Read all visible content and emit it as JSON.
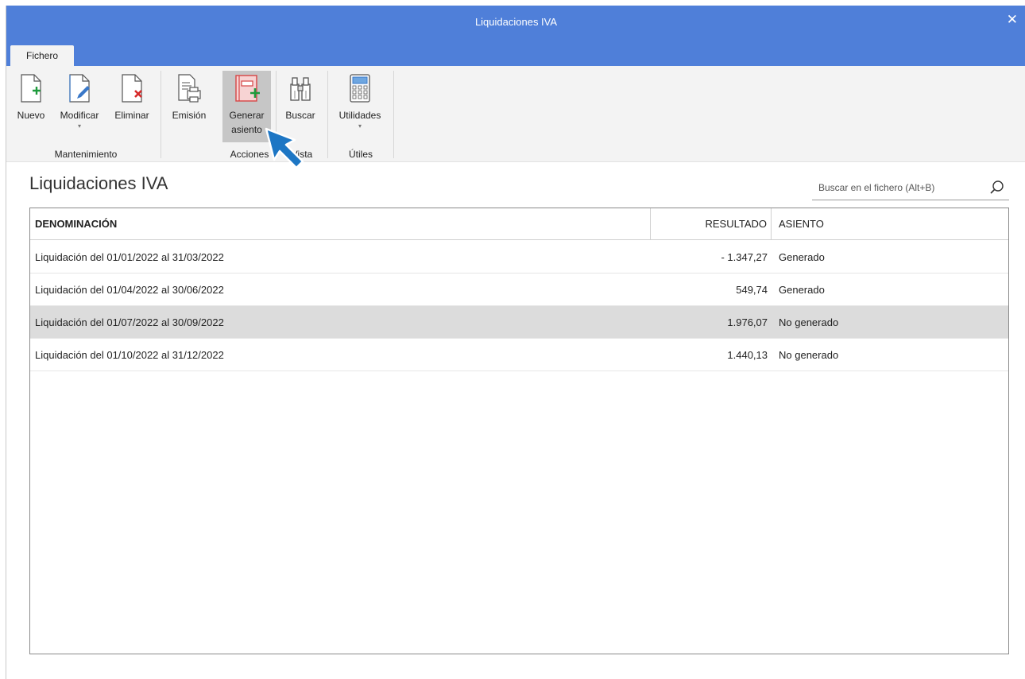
{
  "window": {
    "title": "Liquidaciones IVA",
    "close_glyph": "✕"
  },
  "tabs": [
    {
      "label": "Fichero"
    }
  ],
  "ribbon": {
    "buttons": {
      "nuevo": {
        "label": "Nuevo",
        "icon": "new-document-icon"
      },
      "modificar": {
        "label": "Modificar",
        "icon": "edit-document-icon",
        "caret": "▾"
      },
      "eliminar": {
        "label": "Eliminar",
        "icon": "delete-document-icon"
      },
      "emision": {
        "label": "Emisión",
        "icon": "print-document-icon"
      },
      "generar": {
        "label_line1": "Generar",
        "label_line2": "asiento",
        "icon": "generate-entry-icon"
      },
      "buscar": {
        "label": "Buscar",
        "icon": "binoculars-icon"
      },
      "utilidades": {
        "label": "Utilidades",
        "icon": "calculator-icon",
        "caret": "▾"
      }
    },
    "groups": {
      "mantenimiento": "Mantenimiento",
      "acciones": "Acciones",
      "vista": "Vista",
      "utiles": "Útiles"
    }
  },
  "page": {
    "title": "Liquidaciones IVA",
    "search_placeholder": "Buscar en el fichero (Alt+B)"
  },
  "table": {
    "columns": {
      "denominacion": "DENOMINACIÓN",
      "resultado": "RESULTADO",
      "asiento": "ASIENTO"
    },
    "rows": [
      {
        "denominacion": "Liquidación del 01/01/2022 al 31/03/2022",
        "resultado": "- 1.347,27",
        "asiento": "Generado"
      },
      {
        "denominacion": "Liquidación del 01/04/2022 al 30/06/2022",
        "resultado": "549,74",
        "asiento": "Generado"
      },
      {
        "denominacion": "Liquidación del 01/07/2022 al 30/09/2022",
        "resultado": "1.976,07",
        "asiento": "No generado"
      },
      {
        "denominacion": "Liquidación del 01/10/2022 al 31/12/2022",
        "resultado": "1.440,13",
        "asiento": "No generado"
      }
    ],
    "selected_row": 2
  },
  "colors": {
    "titlebar": "#4f7fd9",
    "ribbon_bg": "#f3f3f3",
    "selected_row": "#dcdcdc",
    "add_green": "#1e9a3c",
    "delete_red": "#d62a2a",
    "cursor_blue": "#1d76c4"
  }
}
